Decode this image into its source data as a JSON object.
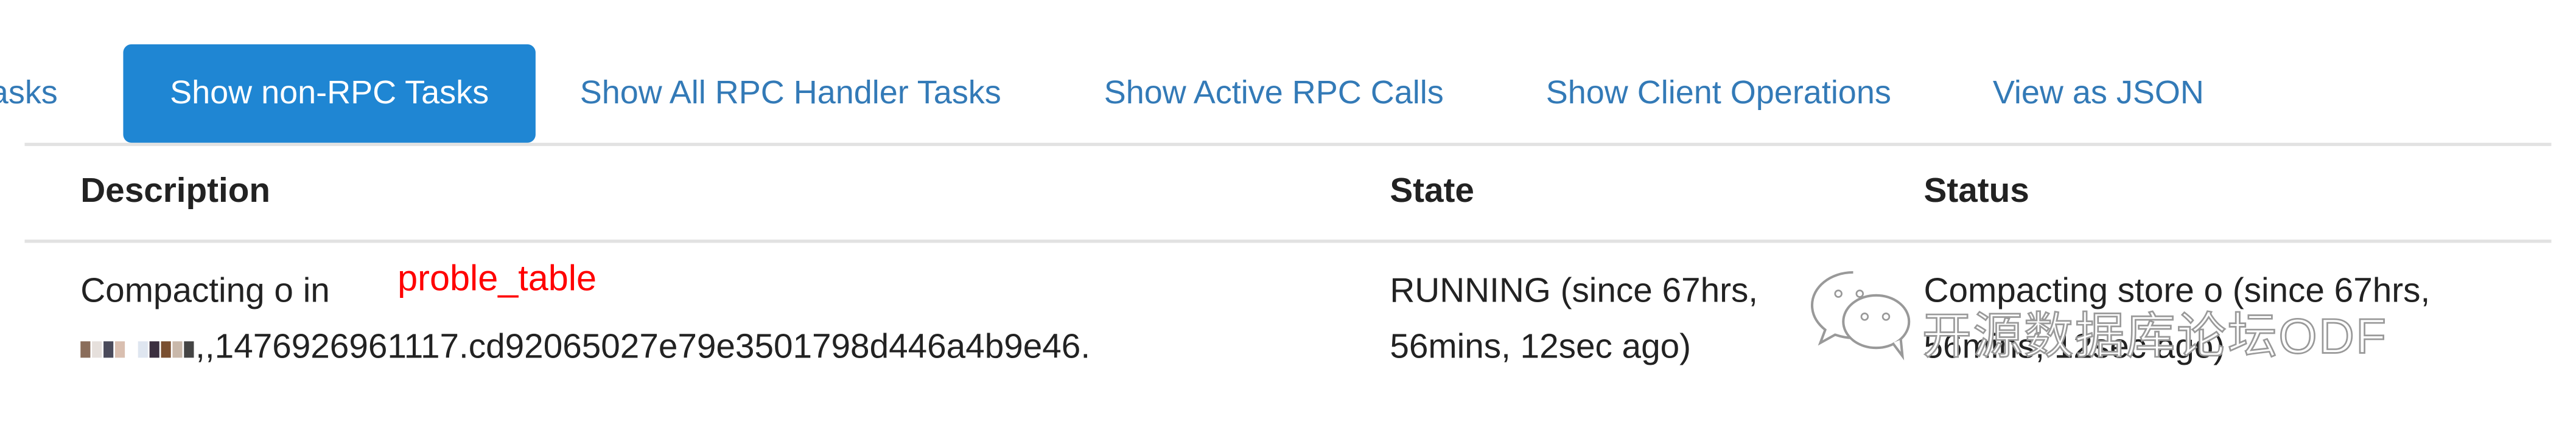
{
  "tabs": [
    {
      "label": "asks",
      "active": false
    },
    {
      "label": "Show non-RPC Tasks",
      "active": true
    },
    {
      "label": "Show All RPC Handler Tasks",
      "active": false
    },
    {
      "label": "Show Active RPC Calls",
      "active": false
    },
    {
      "label": "Show Client Operations",
      "active": false
    },
    {
      "label": "View as JSON",
      "active": false
    }
  ],
  "table": {
    "headers": [
      "Description",
      "State",
      "Status"
    ],
    "rows": [
      {
        "description_line1": "Compacting o in",
        "annotation": "proble_table",
        "description_line2": ",,1476926961117.cd92065027e79e3501798d446a4b9e46.",
        "state_line1": "RUNNING (since 67hrs,",
        "state_line2": "56mins, 12sec ago)",
        "status_line1": "Compacting store o (since 67hrs,",
        "status_line2": "56mins, 12sec ago)"
      }
    ]
  },
  "watermark": {
    "text": "开源数据库论坛ODF",
    "icon": "wechat-icon"
  },
  "colors": {
    "accent": "#1f86d3",
    "link": "#337ab7",
    "annotation": "#ff0000"
  }
}
